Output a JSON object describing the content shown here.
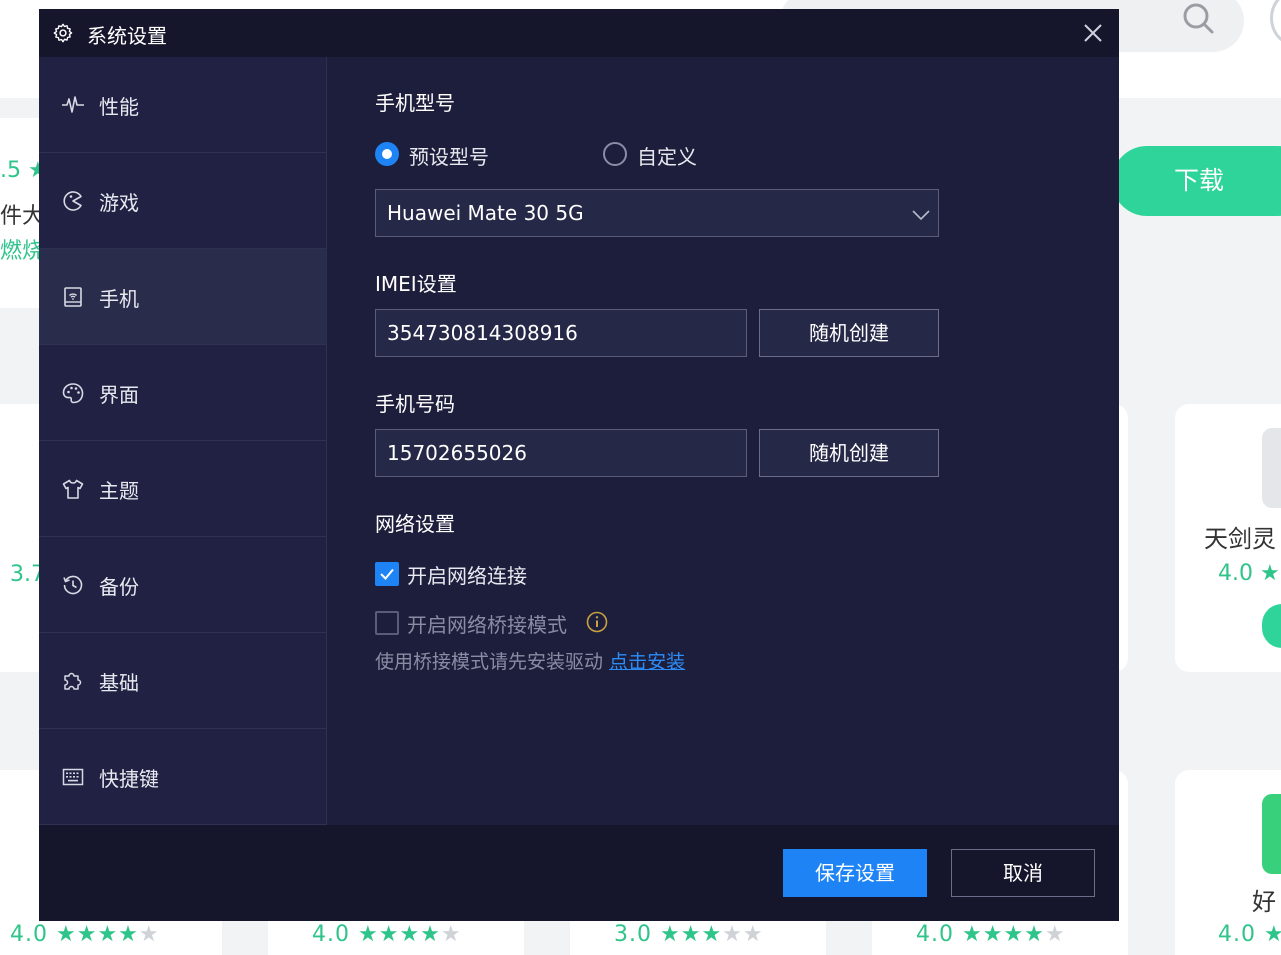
{
  "background": {
    "download_label": "下载",
    "fragments": {
      "rating_left": ".5 ★",
      "text_left_1": "件大",
      "text_left_2": "燃烧",
      "rating_mid_left": "3.7",
      "app_right_name": "天剑灵",
      "app_right_rating": "4.0 ★",
      "app_right_bottom": "好"
    },
    "ratings": [
      {
        "score": "4.0",
        "stars_on": 4
      },
      {
        "score": "4.0",
        "stars_on": 4
      },
      {
        "score": "3.0",
        "stars_on": 3
      },
      {
        "score": "4.0",
        "stars_on": 4
      },
      {
        "score": "4.0",
        "stars_on": 1
      }
    ]
  },
  "dialog": {
    "title": "系统设置",
    "sidebar": {
      "items": [
        {
          "label": "性能",
          "icon": "pulse-icon"
        },
        {
          "label": "游戏",
          "icon": "game-icon"
        },
        {
          "label": "手机",
          "icon": "phone-icon"
        },
        {
          "label": "界面",
          "icon": "palette-icon"
        },
        {
          "label": "主题",
          "icon": "shirt-icon"
        },
        {
          "label": "备份",
          "icon": "history-icon"
        },
        {
          "label": "基础",
          "icon": "puzzle-icon"
        },
        {
          "label": "快捷键",
          "icon": "keyboard-icon"
        }
      ],
      "active_index": 2
    },
    "phone": {
      "model_section_title": "手机型号",
      "radio_preset_label": "预设型号",
      "radio_custom_label": "自定义",
      "selected_radio": "预设型号",
      "model_value": "Huawei Mate 30 5G",
      "imei_section_title": "IMEI设置",
      "imei_value": "354730814308916",
      "imei_random_label": "随机创建",
      "number_section_title": "手机号码",
      "number_value": "15702655026",
      "number_random_label": "随机创建",
      "network_section_title": "网络设置",
      "enable_network_label": "开启网络连接",
      "enable_network_checked": true,
      "bridge_mode_label": "开启网络桥接模式",
      "bridge_mode_checked": false,
      "bridge_hint": "使用桥接模式请先安装驱动",
      "bridge_install_link": "点击安装"
    },
    "footer": {
      "save_label": "保存设置",
      "cancel_label": "取消"
    }
  },
  "colors": {
    "dialog_bg": "#1d1e3c",
    "accent": "#1e84f5",
    "link": "#2d8cf6",
    "bg_green": "#2fd49a"
  }
}
